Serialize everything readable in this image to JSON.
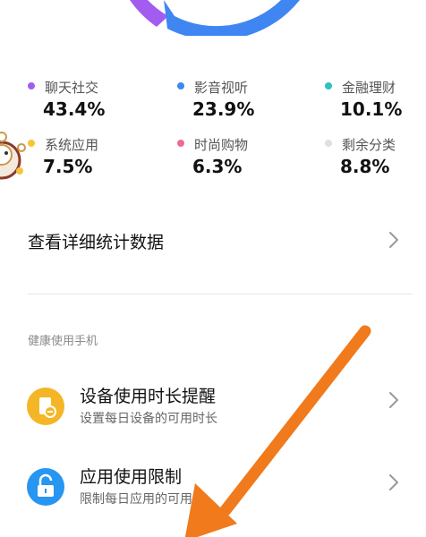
{
  "colors": {
    "purple": "#a35cf0",
    "blue": "#3f86f2",
    "teal": "#29c3c1",
    "yellow": "#f7c531",
    "pink": "#f06a8e",
    "gray": "#e0e0e0",
    "arrow": "#f07a1c",
    "orange_icon": "#f4b626",
    "blue_icon": "#2795f2"
  },
  "legend": [
    {
      "name": "聊天社交",
      "value": "43.4%",
      "color": "#a35cf0"
    },
    {
      "name": "影音视听",
      "value": "23.9%",
      "color": "#3f86f2"
    },
    {
      "name": "金融理财",
      "value": "10.1%",
      "color": "#29c3c1"
    },
    {
      "name": "系统应用",
      "value": "7.5%",
      "color": "#f7c531"
    },
    {
      "name": "时尚购物",
      "value": "6.3%",
      "color": "#f06a8e"
    },
    {
      "name": "剩余分类",
      "value": "8.8%",
      "color": "#e0e0e0"
    }
  ],
  "detail_row": {
    "label": "查看详细统计数据",
    "icon": "chevron-right-icon"
  },
  "section": {
    "title": "健康使用手机"
  },
  "cards": [
    {
      "title": "设备使用时长提醒",
      "subtitle": "设置每日设备的可用时长",
      "icon": "device-timer-icon"
    },
    {
      "title": "应用使用限制",
      "subtitle": "限制每日应用的可用时",
      "icon": "unlock-icon"
    }
  ]
}
